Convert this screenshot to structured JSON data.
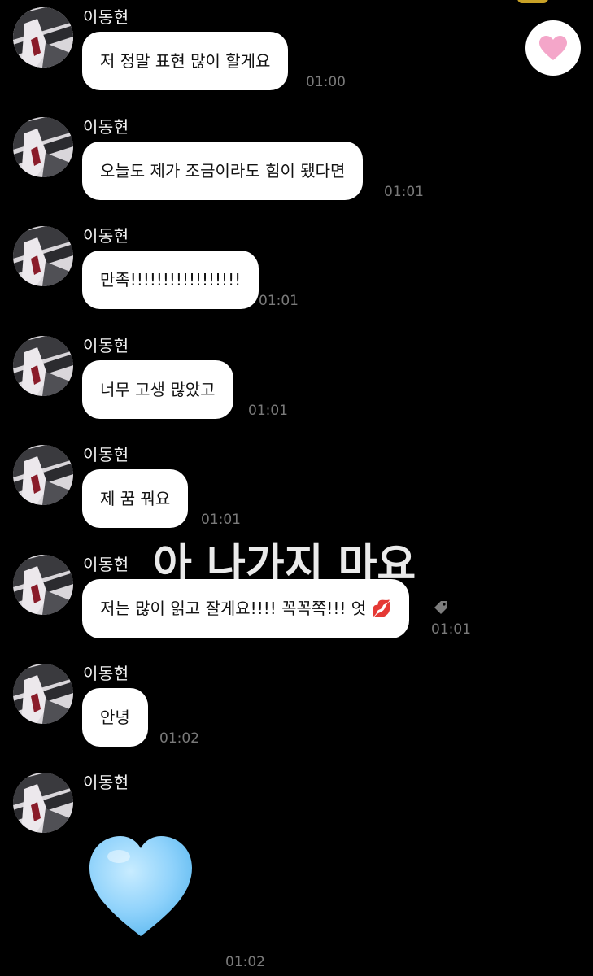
{
  "sender_name": "이동현",
  "overlay_caption": "아 나가지 마요",
  "reaction": {
    "icon": "pink-heart-icon",
    "color": "#f4a6c9"
  },
  "messages": [
    {
      "text": "저 정말 표현 많이 할게요",
      "time": "01:00"
    },
    {
      "text": "오늘도 제가 조금이라도 힘이 됐다면",
      "time": "01:01"
    },
    {
      "text": "만족!!!!!!!!!!!!!!!!!",
      "time": "01:01"
    },
    {
      "text": "너무 고생 많았고",
      "time": "01:01"
    },
    {
      "text": "제 꿈 꿔요",
      "time": "01:01"
    },
    {
      "text": "저는 많이 읽고 잘게요!!!! 꼭꼭쪽!!! 엇",
      "emoji": "💋",
      "time": "01:01"
    },
    {
      "text": "안녕",
      "time": "01:02"
    },
    {
      "emoji": "blue-heart-icon",
      "time": "01:02"
    }
  ]
}
